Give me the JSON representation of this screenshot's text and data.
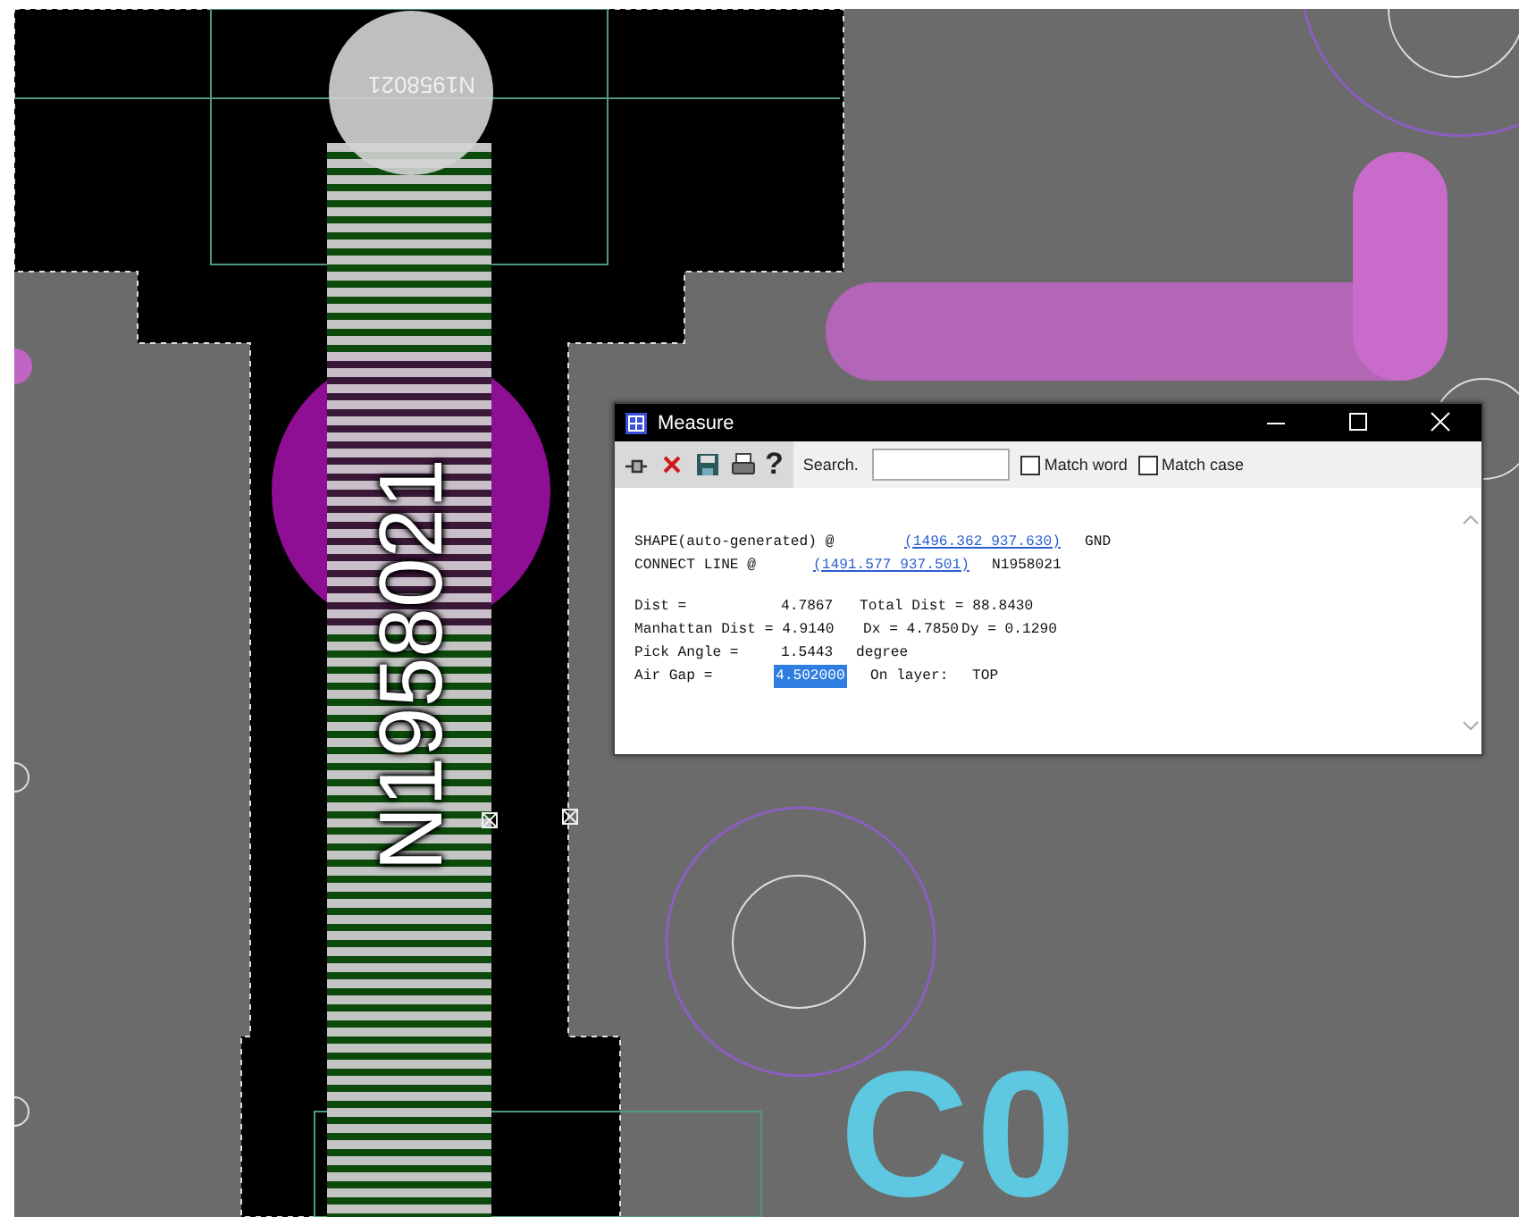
{
  "canvas": {
    "pad_label": "N1958021",
    "trace_label": "N1958021",
    "silkscreen_label": "C0"
  },
  "dialog": {
    "title": "Measure",
    "toolbar": {
      "help_glyph": "?",
      "search_label": "Search.",
      "options": [
        {
          "label": "Match word",
          "checked": false
        },
        {
          "label": "Match case",
          "checked": false
        }
      ]
    },
    "report": [
      [
        {
          "kind": "text",
          "text": "SHAPE(auto-generated) @"
        },
        {
          "kind": "link",
          "text": "(1496.362 937.630)"
        },
        {
          "kind": "text",
          "text": "GND"
        }
      ],
      [
        {
          "kind": "text",
          "text": "CONNECT LINE @"
        },
        {
          "kind": "link",
          "text": "(1491.577 937.501)"
        },
        {
          "kind": "text",
          "text": "N1958021"
        }
      ],
      [
        {
          "kind": "text",
          "text": "Dist ="
        },
        {
          "kind": "text",
          "text": "4.7867"
        },
        {
          "kind": "text",
          "text": "Total Dist = 88.8430"
        }
      ],
      [
        {
          "kind": "text",
          "text": "Manhattan Dist = 4.9140"
        },
        {
          "kind": "text",
          "text": "Dx = 4.7850"
        },
        {
          "kind": "text",
          "text": "Dy = 0.1290"
        }
      ],
      [
        {
          "kind": "text",
          "text": "Pick Angle ="
        },
        {
          "kind": "text",
          "text": "1.5443"
        },
        {
          "kind": "text",
          "text": "degree"
        }
      ],
      [
        {
          "kind": "text",
          "text": "Air Gap ="
        },
        {
          "kind": "highlight",
          "text": "4.502000"
        },
        {
          "kind": "text",
          "text": "On layer:"
        },
        {
          "kind": "text",
          "text": "TOP"
        }
      ]
    ]
  }
}
